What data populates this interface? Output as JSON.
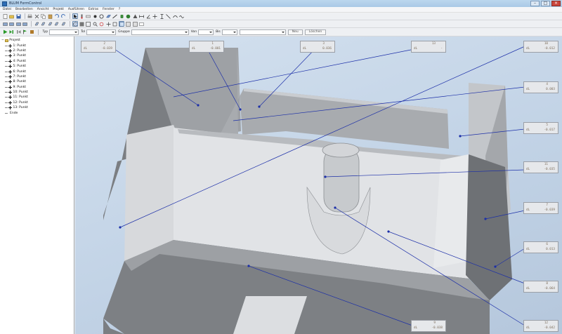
{
  "window": {
    "title": "BLUM FormControl",
    "minimize": "–",
    "maximize": "□",
    "close": "×"
  },
  "menu": [
    "Datei",
    "Bearbeiten",
    "Ansicht",
    "Projekt",
    "Ausführen",
    "Extras",
    "Fenster",
    "?"
  ],
  "icons": {
    "toolbar1": [
      "new-file-icon",
      "open-icon",
      "save-icon",
      "print-icon",
      "cut-icon",
      "copy-icon",
      "paste-icon",
      "undo-icon",
      "redo-icon",
      "select-icon",
      "probe-icon",
      "measure-icon",
      "point-icon",
      "circle-icon",
      "plane-icon",
      "line-icon",
      "cylinder-icon",
      "sphere-icon",
      "cone-icon",
      "distance-icon",
      "angle-icon",
      "width-icon",
      "height-icon",
      "diagonal-icon",
      "curve-icon",
      "spline-icon"
    ],
    "toolbar2": [
      "view-1-icon",
      "view-2-icon",
      "view-3-icon",
      "view-4-icon",
      "view-5-icon",
      "view-6-icon",
      "view-7-icon",
      "view-8-icon",
      "view-9-icon",
      "iso-view-icon",
      "shade-icon",
      "wireframe-icon",
      "zoom-icon",
      "rotate-icon",
      "pan-icon",
      "fit-icon",
      "box-view-icon",
      "box-view-2-icon",
      "box-view-3-icon",
      "label-icon"
    ]
  },
  "filter_bar": {
    "typ_label": "Typ",
    "tol_label": "Tol",
    "gruppe_label": "Gruppe",
    "von_label": "Von",
    "bis_label": "Bis",
    "typ_value": "",
    "tol_value": "",
    "gruppe_value": "",
    "von_value": "",
    "bis_value": "",
    "neu_button": "Neu",
    "loeschen_button": "Löschen"
  },
  "tree": {
    "root": "Projekt",
    "items": [
      "1: Punkt",
      "2: Punkt",
      "3: Punkt",
      "4: Punkt",
      "5: Punkt",
      "6: Punkt",
      "7: Punkt",
      "8: Punkt",
      "9: Punkt",
      "10: Punkt",
      "11: Punkt",
      "12: Punkt",
      "13: Punkt"
    ],
    "end": "Ende"
  },
  "labels": [
    {
      "num": "2",
      "key": "dL",
      "val": "-0.039"
    },
    {
      "num": "1",
      "key": "dL",
      "val": "-0.001"
    },
    {
      "num": "3",
      "key": "dL",
      "val": "0.036"
    },
    {
      "num": "13",
      "key": "dL",
      "val": "-"
    },
    {
      "num": "10",
      "key": "dL",
      "val": "-0.012"
    },
    {
      "num": "4",
      "key": "dL",
      "val": "0.003"
    },
    {
      "num": "5",
      "key": "dL",
      "val": "-0.017"
    },
    {
      "num": "11",
      "key": "dL",
      "val": "-0.035"
    },
    {
      "num": "7",
      "key": "dL",
      "val": "-0.039"
    },
    {
      "num": "6",
      "key": "dL",
      "val": "0.013"
    },
    {
      "num": "8",
      "key": "dL",
      "val": "-0.064"
    },
    {
      "num": "9",
      "key": "dL",
      "val": "-0.038"
    },
    {
      "num": "12",
      "key": "dL",
      "val": "-0.042"
    }
  ],
  "colors": {
    "leader": "#1c2fa8",
    "label_text": "#7d6e5c",
    "background_top": "#d4e1ef"
  }
}
